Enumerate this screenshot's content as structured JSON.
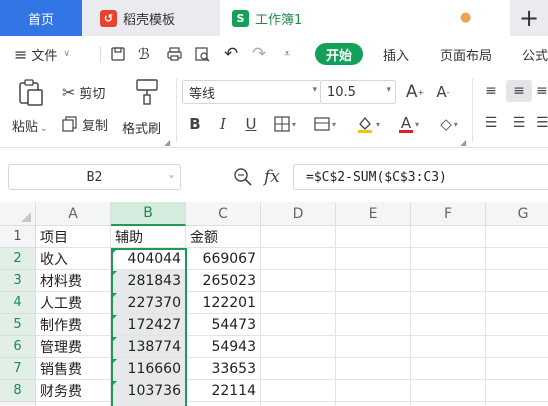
{
  "tabs": {
    "home": "首页",
    "template": "稻壳模板",
    "workbook": "工作簿1",
    "new_tab": "+"
  },
  "menu": {
    "file": "文件",
    "start": "开始",
    "insert": "插入",
    "layout": "页面布局",
    "formula": "公式"
  },
  "ribbon": {
    "paste": "粘贴",
    "cut": "剪切",
    "copy": "复制",
    "format_painter": "格式刷",
    "font_name": "等线",
    "font_size": "10.5",
    "bold": "B",
    "italic": "I",
    "underline": "U",
    "font_color_letter": "A",
    "grow": "A",
    "shrink": "A"
  },
  "formula_bar": {
    "name_box": "B2",
    "fx": "fx",
    "formula": "=$C$2-SUM($C$3:C3)"
  },
  "grid": {
    "columns": [
      "A",
      "B",
      "C",
      "D",
      "E",
      "F",
      "G"
    ],
    "rows": [
      {
        "num": "1",
        "a": "项目",
        "b": "辅助",
        "c": "金额"
      },
      {
        "num": "2",
        "a": "收入",
        "b": "404044",
        "c": "669067"
      },
      {
        "num": "3",
        "a": "材料费",
        "b": "281843",
        "c": "265023"
      },
      {
        "num": "4",
        "a": "人工费",
        "b": "227370",
        "c": "122201"
      },
      {
        "num": "5",
        "a": "制作费",
        "b": "172427",
        "c": "54473"
      },
      {
        "num": "6",
        "a": "管理费",
        "b": "138774",
        "c": "54943"
      },
      {
        "num": "7",
        "a": "销售费",
        "b": "116660",
        "c": "33653"
      },
      {
        "num": "8",
        "a": "财务费",
        "b": "103736",
        "c": "22114"
      }
    ]
  },
  "colors": {
    "accent": "#3276e6",
    "green": "#15a05a",
    "selection": "#1f9a55"
  }
}
